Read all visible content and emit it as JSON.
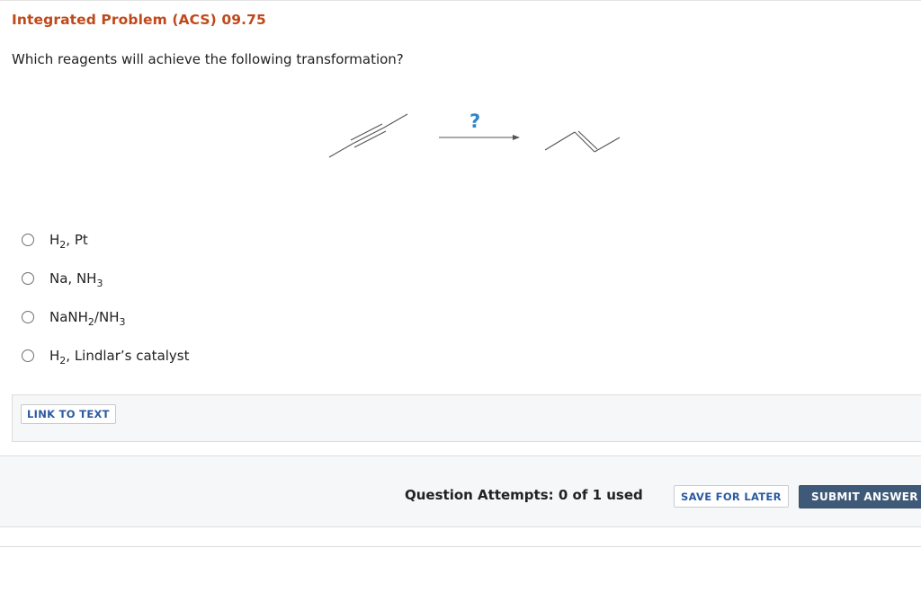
{
  "question": {
    "title": "Integrated Problem (ACS) 09.75",
    "prompt": "Which reagents will achieve the following transformation?",
    "reaction_arrow_label": "?"
  },
  "options": [
    {
      "label_parts": [
        "H",
        "2",
        ", Pt"
      ]
    },
    {
      "label_parts": [
        "Na, NH",
        "3"
      ]
    },
    {
      "label_parts": [
        "NaNH",
        "2",
        "/NH",
        "3"
      ]
    },
    {
      "label_parts": [
        "H",
        "2",
        ", Lindlar’s catalyst"
      ]
    }
  ],
  "link_panel": {
    "link_to_text_label": "LINK TO TEXT"
  },
  "footer": {
    "attempts_text": "Question Attempts: 0 of 1 used",
    "save_label": "SAVE FOR LATER",
    "submit_label": "SUBMIT ANSWER"
  },
  "colors": {
    "title": "#c0491b",
    "accent_link": "#2c5aa0",
    "question_mark": "#2f86c9",
    "submit_bg": "#3f5a78"
  },
  "icons": [
    "radio-unchecked-icon",
    "alkyne-structure",
    "reaction-arrow-icon",
    "trans-alkene-structure"
  ]
}
